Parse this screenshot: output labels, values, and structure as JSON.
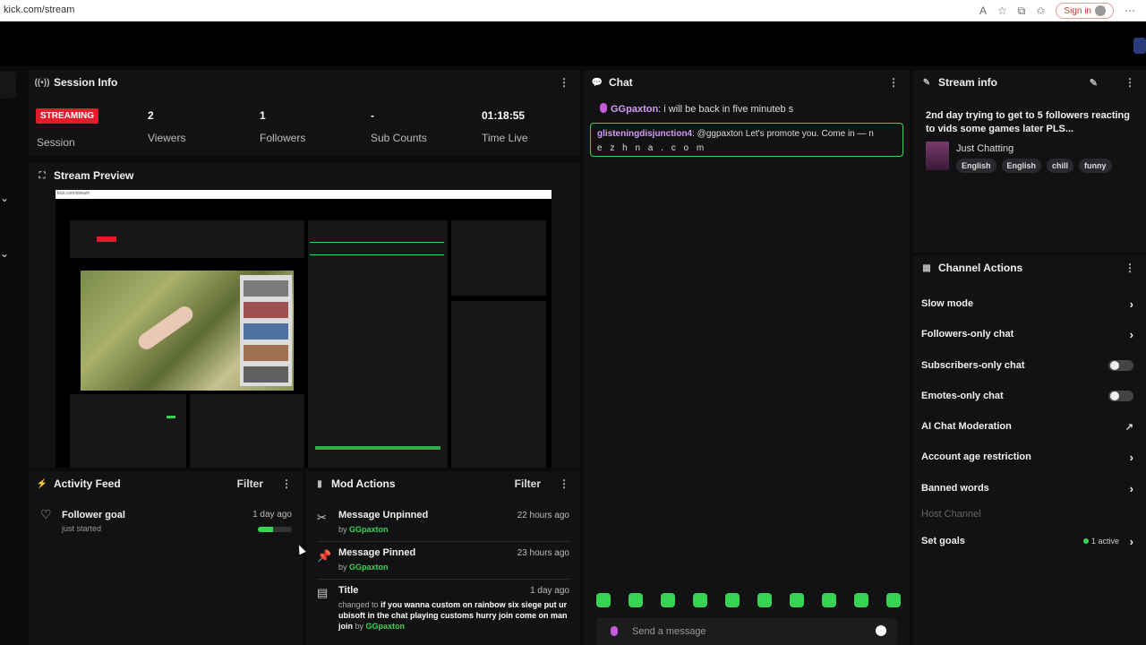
{
  "browser": {
    "url": "kick.com/stream",
    "signin_label": "Sign in"
  },
  "session_info": {
    "title": "Session Info",
    "status_badge": "STREAMING",
    "session_label": "Session",
    "stats": [
      {
        "value": "2",
        "label": "Viewers"
      },
      {
        "value": "1",
        "label": "Followers"
      },
      {
        "value": "-",
        "label": "Sub Counts"
      },
      {
        "value": "01:18:55",
        "label": "Time Live"
      }
    ]
  },
  "stream_preview": {
    "title": "Stream Preview"
  },
  "activity_feed": {
    "title": "Activity Feed",
    "filter_label": "Filter",
    "items": [
      {
        "title": "Follower goal",
        "subtitle": "just started",
        "time": "1 day ago",
        "progress_percent": 45
      }
    ]
  },
  "mod_actions": {
    "title": "Mod Actions",
    "filter_label": "Filter",
    "items": [
      {
        "title": "Message Unpinned",
        "by_prefix": "by",
        "by": "GGpaxton",
        "time": "22 hours ago"
      },
      {
        "title": "Message Pinned",
        "by_prefix": "by",
        "by": "GGpaxton",
        "time": "23 hours ago"
      },
      {
        "title": "Title",
        "changed_to": "changed to",
        "value": "if you wanna custom on rainbow six siege put ur ubisoft in the chat playing customs hurry join come on man join",
        "by_prefix": "by",
        "by": "GGpaxton",
        "time": "1 day ago"
      }
    ]
  },
  "chat": {
    "title": "Chat",
    "messages": [
      {
        "user": "GGpaxton",
        "text": ": i will be back in five minuteb s"
      }
    ],
    "pinned": {
      "user": "glisteningdisjunction4",
      "text": ": @ggpaxton Let's promote you. Come in — n",
      "text2": "e z h n a . c o m"
    },
    "send_placeholder": "Send a message",
    "emote_count": 10,
    "accent_color": "#39d353"
  },
  "stream_info": {
    "title": "Stream info",
    "stream_title": "2nd day trying to get to 5 followers reacting to vids some games later PLS...",
    "category": "Just Chatting",
    "tags": [
      "English",
      "English",
      "chill",
      "funny"
    ]
  },
  "channel_actions": {
    "title": "Channel Actions",
    "rows": [
      {
        "label": "Slow mode",
        "control": "chevron"
      },
      {
        "label": "Followers-only chat",
        "control": "chevron"
      },
      {
        "label": "Subscribers-only chat",
        "control": "toggle"
      },
      {
        "label": "Emotes-only chat",
        "control": "toggle"
      },
      {
        "label": "AI Chat Moderation",
        "control": "external"
      },
      {
        "label": "Account age restriction",
        "control": "chevron"
      },
      {
        "label": "Banned words",
        "control": "chevron"
      },
      {
        "label": "Host Channel",
        "control": "disabled"
      },
      {
        "label": "Set goals",
        "control": "chevron",
        "badge": "1 active"
      }
    ]
  },
  "colors": {
    "streaming_red": "#e11d2b",
    "kick_green": "#39d353",
    "username_purple": "#d49bf5"
  }
}
